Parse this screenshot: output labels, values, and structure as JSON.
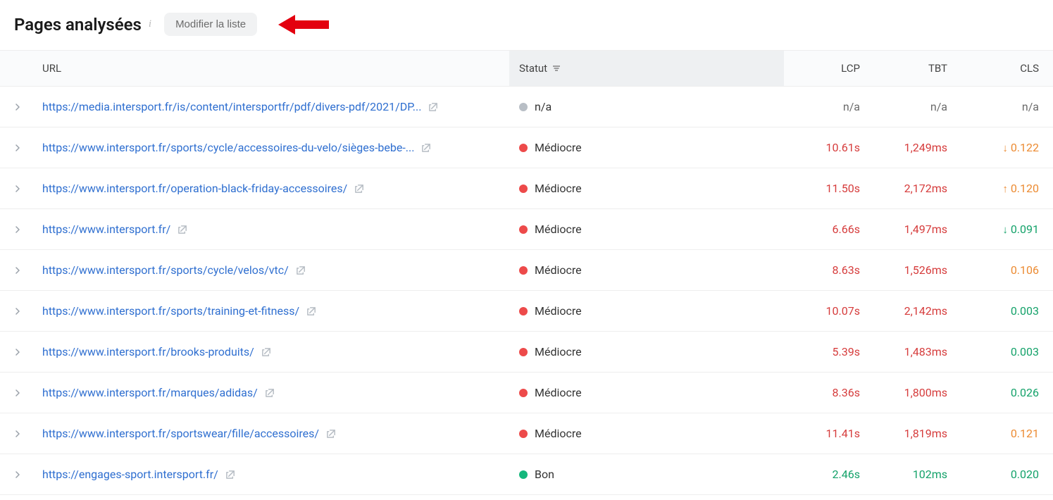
{
  "header": {
    "title": "Pages analysées",
    "modify_label": "Modifier la liste"
  },
  "columns": {
    "url": "URL",
    "status": "Statut",
    "lcp": "LCP",
    "tbt": "TBT",
    "cls": "CLS"
  },
  "status_colors": {
    "na": "#b8bec5",
    "mediocre": "#ed4a4a",
    "bon": "#14b77c"
  },
  "metric_colors": {
    "na": "#6b6b6b",
    "red": "#d63c3c",
    "orange": "#ec8b32",
    "green": "#14a26a"
  },
  "rows": [
    {
      "url": "https://media.intersport.fr/is/content/intersportfr/pdf/divers-pdf/2021/DP...",
      "status_label": "n/a",
      "status_color_key": "na",
      "lcp": "n/a",
      "lcp_color_key": "na",
      "tbt": "n/a",
      "tbt_color_key": "na",
      "cls": "n/a",
      "cls_color_key": "na",
      "cls_trend": null,
      "cls_trend_color_key": null
    },
    {
      "url": "https://www.intersport.fr/sports/cycle/accessoires-du-velo/sièges-bebe-...",
      "status_label": "Médiocre",
      "status_color_key": "mediocre",
      "lcp": "10.61s",
      "lcp_color_key": "red",
      "tbt": "1,249ms",
      "tbt_color_key": "red",
      "cls": "0.122",
      "cls_color_key": "orange",
      "cls_trend": "↓",
      "cls_trend_color_key": "orange"
    },
    {
      "url": "https://www.intersport.fr/operation-black-friday-accessoires/",
      "status_label": "Médiocre",
      "status_color_key": "mediocre",
      "lcp": "11.50s",
      "lcp_color_key": "red",
      "tbt": "2,172ms",
      "tbt_color_key": "red",
      "cls": "0.120",
      "cls_color_key": "orange",
      "cls_trend": "↑",
      "cls_trend_color_key": "orange"
    },
    {
      "url": "https://www.intersport.fr/",
      "status_label": "Médiocre",
      "status_color_key": "mediocre",
      "lcp": "6.66s",
      "lcp_color_key": "red",
      "tbt": "1,497ms",
      "tbt_color_key": "red",
      "cls": "0.091",
      "cls_color_key": "green",
      "cls_trend": "↓",
      "cls_trend_color_key": "green"
    },
    {
      "url": "https://www.intersport.fr/sports/cycle/velos/vtc/",
      "status_label": "Médiocre",
      "status_color_key": "mediocre",
      "lcp": "8.63s",
      "lcp_color_key": "red",
      "tbt": "1,526ms",
      "tbt_color_key": "red",
      "cls": "0.106",
      "cls_color_key": "orange",
      "cls_trend": null,
      "cls_trend_color_key": null
    },
    {
      "url": "https://www.intersport.fr/sports/training-et-fitness/",
      "status_label": "Médiocre",
      "status_color_key": "mediocre",
      "lcp": "10.07s",
      "lcp_color_key": "red",
      "tbt": "2,142ms",
      "tbt_color_key": "red",
      "cls": "0.003",
      "cls_color_key": "green",
      "cls_trend": null,
      "cls_trend_color_key": null
    },
    {
      "url": "https://www.intersport.fr/brooks-produits/",
      "status_label": "Médiocre",
      "status_color_key": "mediocre",
      "lcp": "5.39s",
      "lcp_color_key": "red",
      "tbt": "1,483ms",
      "tbt_color_key": "red",
      "cls": "0.003",
      "cls_color_key": "green",
      "cls_trend": null,
      "cls_trend_color_key": null
    },
    {
      "url": "https://www.intersport.fr/marques/adidas/",
      "status_label": "Médiocre",
      "status_color_key": "mediocre",
      "lcp": "8.36s",
      "lcp_color_key": "red",
      "tbt": "1,800ms",
      "tbt_color_key": "red",
      "cls": "0.026",
      "cls_color_key": "green",
      "cls_trend": null,
      "cls_trend_color_key": null
    },
    {
      "url": "https://www.intersport.fr/sportswear/fille/accessoires/",
      "status_label": "Médiocre",
      "status_color_key": "mediocre",
      "lcp": "11.41s",
      "lcp_color_key": "red",
      "tbt": "1,819ms",
      "tbt_color_key": "red",
      "cls": "0.121",
      "cls_color_key": "orange",
      "cls_trend": null,
      "cls_trend_color_key": null
    },
    {
      "url": "https://engages-sport.intersport.fr/",
      "status_label": "Bon",
      "status_color_key": "bon",
      "lcp": "2.46s",
      "lcp_color_key": "green",
      "tbt": "102ms",
      "tbt_color_key": "green",
      "cls": "0.020",
      "cls_color_key": "green",
      "cls_trend": null,
      "cls_trend_color_key": null
    }
  ]
}
